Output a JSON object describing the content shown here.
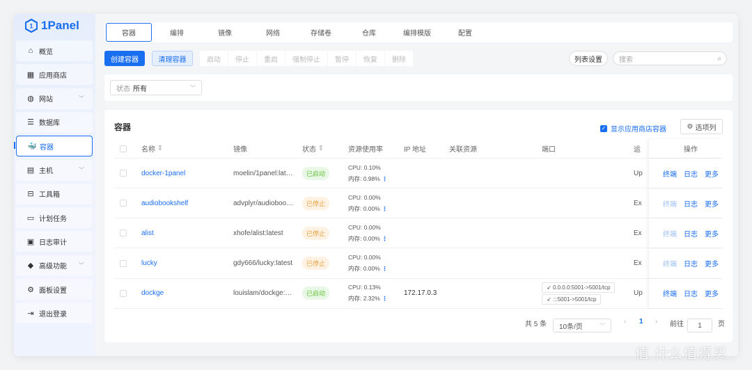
{
  "app": {
    "logo": "1Panel",
    "accent": "#1a6ef0"
  },
  "sidebar": {
    "items": [
      {
        "label": "概览",
        "icon": "home-icon",
        "glyph": "⌂"
      },
      {
        "label": "应用商店",
        "icon": "apps-grid-icon",
        "glyph": "▦"
      },
      {
        "label": "网站",
        "icon": "globe-icon",
        "glyph": "◍",
        "chevron": true
      },
      {
        "label": "数据库",
        "icon": "database-layers-icon",
        "glyph": "☰"
      },
      {
        "label": "容器",
        "icon": "docker-icon",
        "glyph": "🐳",
        "active": true
      },
      {
        "label": "主机",
        "icon": "server-icon",
        "glyph": "▤",
        "chevron": true
      },
      {
        "label": "工具箱",
        "icon": "toolbox-icon",
        "glyph": "⊟"
      },
      {
        "label": "计划任务",
        "icon": "calendar-icon",
        "glyph": "▭"
      },
      {
        "label": "日志审计",
        "icon": "log-icon",
        "glyph": "▣"
      },
      {
        "label": "高级功能",
        "icon": "diamond-icon",
        "glyph": "◆",
        "chevron": true
      },
      {
        "label": "面板设置",
        "icon": "gear-icon",
        "glyph": "⚙"
      },
      {
        "label": "退出登录",
        "icon": "logout-icon",
        "glyph": "⇥"
      }
    ]
  },
  "tabs": [
    "容器",
    "编排",
    "镜像",
    "网络",
    "存储卷",
    "仓库",
    "编排模版",
    "配置"
  ],
  "toolbar": {
    "create": "创建容器",
    "clean": "清理容器",
    "actions": [
      "启动",
      "停止",
      "重启",
      "强制停止",
      "暂停",
      "恢复",
      "删除"
    ],
    "list_settings": "列表设置",
    "search_placeholder": "搜索"
  },
  "filter": {
    "label": "状态",
    "value": "所有"
  },
  "table": {
    "title": "容器",
    "show_app_store": "显示应用商店容器",
    "columns_button": "选项列",
    "headers": {
      "name": "名称",
      "image": "镜像",
      "status": "状态",
      "resource": "资源使用率",
      "ip": "IP 地址",
      "related": "关联资源",
      "ports": "端口",
      "uptime": "运",
      "ops": "操作"
    },
    "rows": [
      {
        "name": "docker-1panel",
        "image": "moelin/1panel:lat…",
        "status": "已启动",
        "running": true,
        "cpu": "CPU: 0.10%",
        "mem": "内存: 0.98%",
        "ip": "",
        "ports": [],
        "uptime": "Up"
      },
      {
        "name": "audiobookshelf",
        "image": "advplyr/audioboo…",
        "status": "已停止",
        "running": false,
        "cpu": "CPU: 0.00%",
        "mem": "内存: 0.00%",
        "ip": "",
        "ports": [],
        "uptime": "Ex"
      },
      {
        "name": "alist",
        "image": "xhofe/alist:latest",
        "status": "已停止",
        "running": false,
        "cpu": "CPU: 0.00%",
        "mem": "内存: 0.00%",
        "ip": "",
        "ports": [],
        "uptime": "Ex"
      },
      {
        "name": "lucky",
        "image": "gdy666/lucky:latest",
        "status": "已停止",
        "running": false,
        "cpu": "CPU: 0.00%",
        "mem": "内存: 0.00%",
        "ip": "",
        "ports": [],
        "uptime": "Ex"
      },
      {
        "name": "dockge",
        "image": "louislam/dockge:…",
        "status": "已启动",
        "running": true,
        "cpu": "CPU: 0.13%",
        "mem": "内存: 2.32%",
        "ip": "172.17.0.3",
        "ports": [
          "0.0.0.0:5001->5001/tcp",
          ":::5001->5001/tcp"
        ],
        "uptime": "Up"
      }
    ],
    "ops": [
      "终端",
      "日志",
      "更多"
    ]
  },
  "pagination": {
    "total": "共 5 条",
    "page_size": "10条/页",
    "current": "1",
    "goto_label": "前往",
    "goto_value": "1",
    "page_unit": "页"
  },
  "watermark": "值 什么值得买"
}
